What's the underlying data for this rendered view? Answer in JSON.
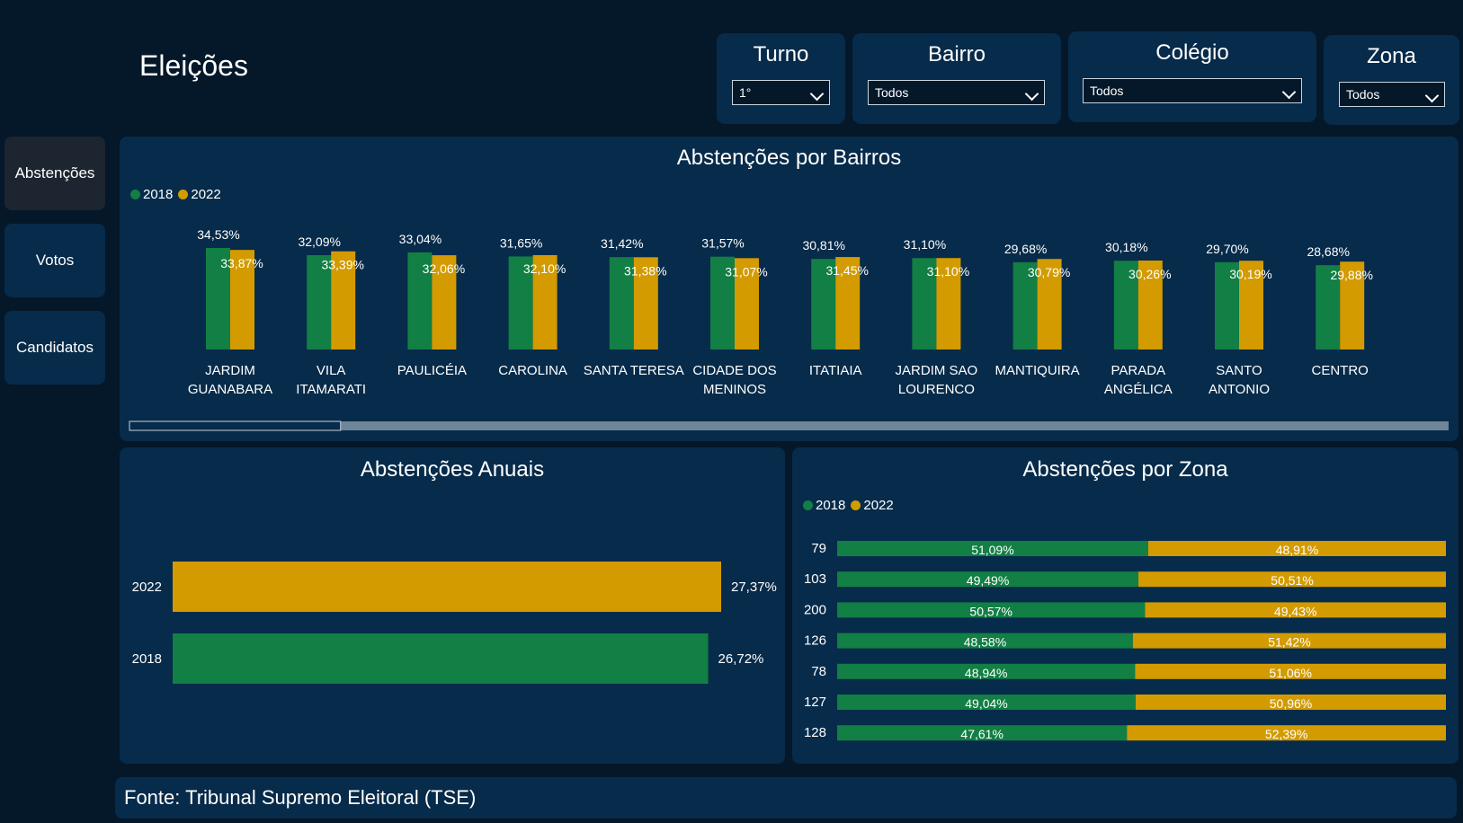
{
  "app": {
    "title": "Eleições"
  },
  "filters": [
    {
      "label": "Turno",
      "value": "1°"
    },
    {
      "label": "Bairro",
      "value": "Todos"
    },
    {
      "label": "Colégio",
      "value": "Todos"
    },
    {
      "label": "Zona",
      "value": "Todos"
    }
  ],
  "nav": [
    {
      "label": "Abstenções",
      "active": true
    },
    {
      "label": "Votos",
      "active": false
    },
    {
      "label": "Candidatos",
      "active": false
    }
  ],
  "colors": {
    "green": "#127f45",
    "gold": "#d39b00",
    "panel": "#072b4a",
    "background": "#04182a"
  },
  "legend": {
    "s2018": "2018",
    "s2022": "2022"
  },
  "footer": {
    "text": "Fonte: Tribunal Supremo Eleitoral (TSE)"
  },
  "chart_data": [
    {
      "type": "bar",
      "title": "Abstenções por Bairros",
      "categories": [
        [
          "JARDIM",
          "GUANABARA"
        ],
        [
          "VILA",
          "ITAMARATI"
        ],
        [
          "PAULICÉIA"
        ],
        [
          "CAROLINA"
        ],
        [
          "SANTA TERESA"
        ],
        [
          "CIDADE DOS",
          "MENINOS"
        ],
        [
          "ITATIAIA"
        ],
        [
          "JARDIM SAO",
          "LOURENCO"
        ],
        [
          "MANTIQUIRA"
        ],
        [
          "PARADA",
          "ANGÉLICA"
        ],
        [
          "SANTO",
          "ANTONIO"
        ],
        [
          "CENTRO"
        ]
      ],
      "series": [
        {
          "name": "2018",
          "values": [
            34.53,
            32.09,
            33.04,
            31.65,
            31.42,
            31.57,
            30.81,
            31.1,
            29.68,
            30.18,
            29.7,
            28.68
          ],
          "labels": [
            "34,53%",
            "32,09%",
            "33,04%",
            "31,65%",
            "31,42%",
            "31,57%",
            "30,81%",
            "31,10%",
            "29,68%",
            "30,18%",
            "29,70%",
            "28,68%"
          ]
        },
        {
          "name": "2022",
          "values": [
            33.87,
            33.39,
            32.06,
            32.1,
            31.38,
            31.07,
            31.45,
            31.1,
            30.79,
            30.26,
            30.19,
            29.88
          ],
          "labels": [
            "33,87%",
            "33,39%",
            "32,06%",
            "32,10%",
            "31,38%",
            "31,07%",
            "31,45%",
            "31,10%",
            "30,79%",
            "30,26%",
            "30,19%",
            "29,88%"
          ]
        }
      ],
      "legend": "top-left",
      "scrollbar_fraction": 0.16
    },
    {
      "type": "bar",
      "orientation": "horizontal",
      "title": "Abstenções Anuais",
      "categories": [
        "2022",
        "2018"
      ],
      "values": [
        27.37,
        26.72
      ],
      "labels": [
        "27,37%",
        "26,72%"
      ]
    },
    {
      "type": "bar",
      "orientation": "horizontal",
      "stacked": "percent",
      "title": "Abstenções por Zona",
      "categories": [
        "79",
        "103",
        "200",
        "126",
        "78",
        "127",
        "128"
      ],
      "series": [
        {
          "name": "2018",
          "values": [
            51.09,
            49.49,
            50.57,
            48.58,
            48.94,
            49.04,
            47.61
          ],
          "labels": [
            "51,09%",
            "49,49%",
            "50,57%",
            "48,58%",
            "48,94%",
            "49,04%",
            "47,61%"
          ]
        },
        {
          "name": "2022",
          "values": [
            48.91,
            50.51,
            49.43,
            51.42,
            51.06,
            50.96,
            52.39
          ],
          "labels": [
            "48,91%",
            "50,51%",
            "49,43%",
            "51,42%",
            "51,06%",
            "50,96%",
            "52,39%"
          ]
        }
      ],
      "legend": "top-left"
    }
  ]
}
